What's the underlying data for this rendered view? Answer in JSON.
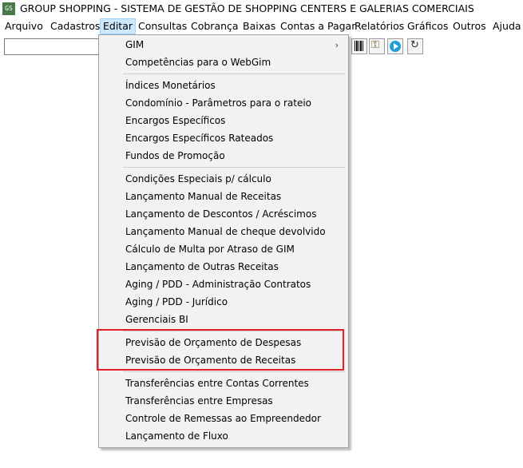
{
  "titlebar": {
    "icon_text": "GS",
    "title": "GROUP SHOPPING - SISTEMA DE GESTÃO DE SHOPPING CENTERS E GALERIAS COMERCIAIS"
  },
  "menubar": {
    "items": [
      "Arquivo",
      "Cadastros",
      "Editar",
      "Consultas",
      "Cobrança",
      "Baixas",
      "Contas a Pagar",
      "Relatórios",
      "Gráficos",
      "Outros",
      "Ajuda"
    ],
    "active": "Editar"
  },
  "toolbar": {
    "search_value": "",
    "icons": [
      "barcode-icon",
      "key-icon",
      "play-icon",
      "refresh-icon"
    ]
  },
  "edit_menu": {
    "groups": [
      {
        "items": [
          {
            "label": "GIM",
            "submenu": true
          },
          {
            "label": "Competências para o WebGim"
          }
        ]
      },
      {
        "items": [
          {
            "label": "Índices Monetários"
          },
          {
            "label": "Condomínio - Parâmetros para o rateio"
          },
          {
            "label": "Encargos Específicos"
          },
          {
            "label": "Encargos Específicos Rateados"
          },
          {
            "label": "Fundos de Promoção"
          }
        ]
      },
      {
        "items": [
          {
            "label": "Condições Especiais p/ cálculo"
          },
          {
            "label": "Lançamento Manual de Receitas"
          },
          {
            "label": "Lançamento de Descontos / Acréscimos"
          },
          {
            "label": "Lançamento Manual de cheque devolvido"
          },
          {
            "label": "Cálculo de Multa por Atraso de GIM"
          },
          {
            "label": "Lançamento de Outras Receitas"
          },
          {
            "label": "Aging / PDD - Administração Contratos"
          },
          {
            "label": "Aging / PDD - Jurídico"
          },
          {
            "label": "Gerenciais BI"
          }
        ]
      },
      {
        "items": [
          {
            "label": "Previsão de Orçamento de Despesas"
          },
          {
            "label": "Previsão de Orçamento de Receitas"
          }
        ]
      },
      {
        "items": [
          {
            "label": "Transferências entre Contas Correntes"
          },
          {
            "label": "Transferências entre Empresas"
          },
          {
            "label": "Controle de Remessas ao Empreendedor"
          },
          {
            "label": "Lançamento de Fluxo"
          }
        ]
      }
    ]
  },
  "annotation": {
    "color": "#e0202a"
  }
}
